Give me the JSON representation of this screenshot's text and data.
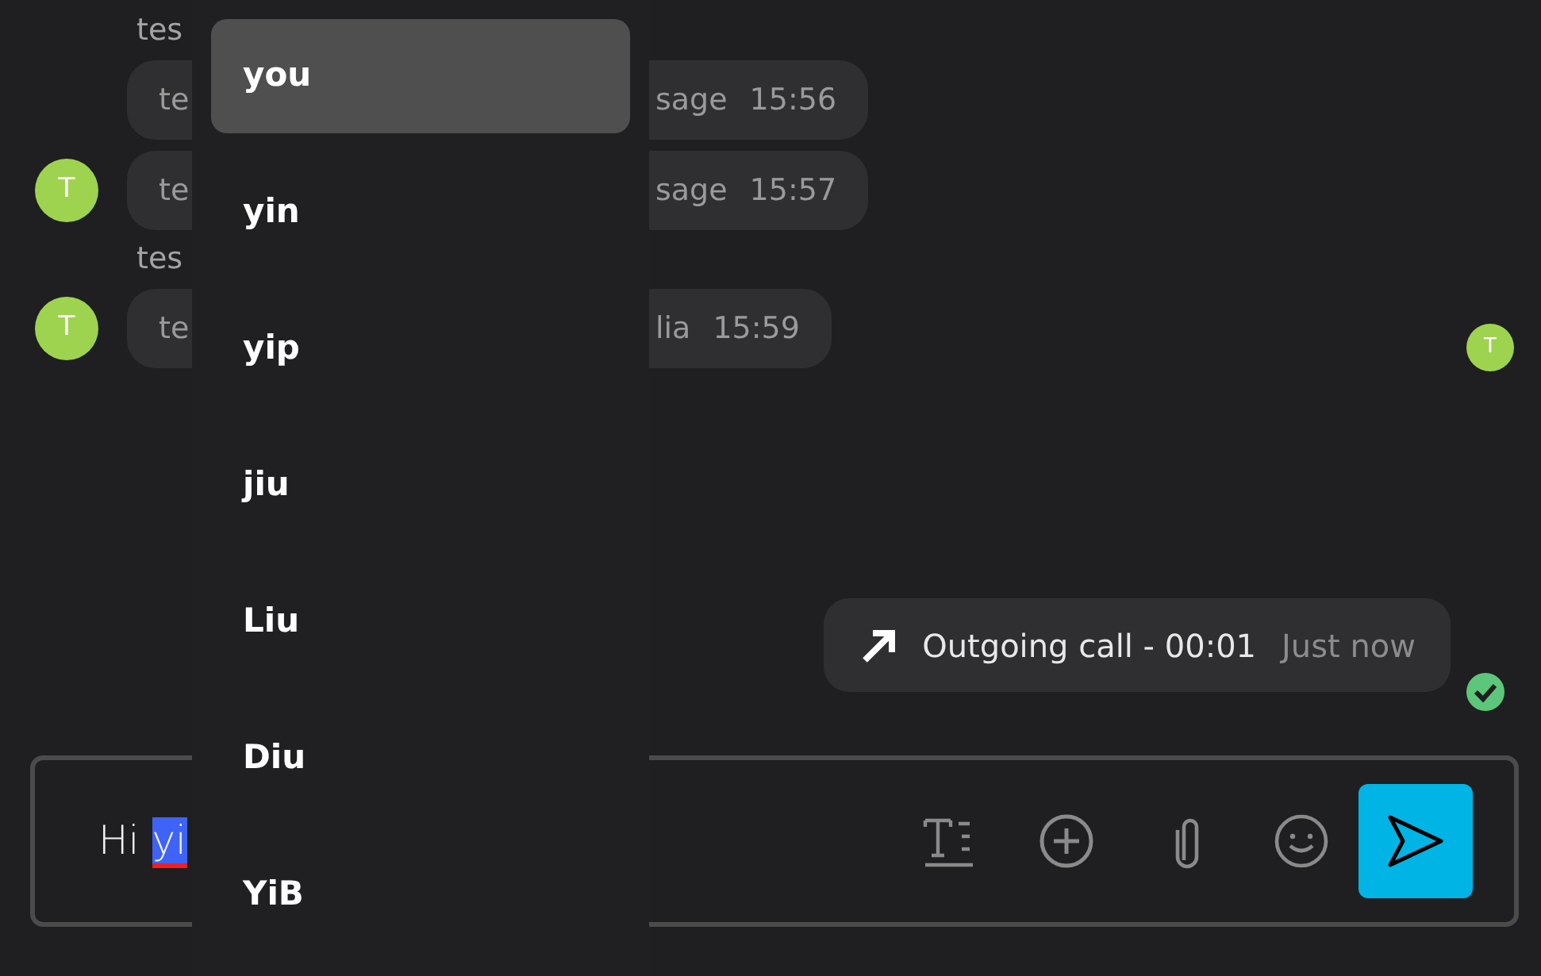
{
  "messages": [
    {
      "kind": "sender",
      "name": "tes"
    },
    {
      "kind": "bubble",
      "start": "te",
      "end": "sage",
      "time": "15:56"
    },
    {
      "kind": "bubble",
      "avatar": "T",
      "start": "te",
      "end": "sage",
      "time": "15:57"
    },
    {
      "kind": "sender",
      "name": "tes"
    },
    {
      "kind": "bubble",
      "avatar": "T",
      "start": "te",
      "end": "lia",
      "time": "15:59",
      "reader": "T"
    }
  ],
  "call": {
    "label": "Outgoing call - 00:01",
    "time": "Just now",
    "delivered": true
  },
  "composer": {
    "text": "Hi",
    "selection": "yi"
  },
  "suggestions": [
    {
      "label": "you",
      "selected": true
    },
    {
      "label": "yin",
      "selected": false
    },
    {
      "label": "yip",
      "selected": false
    },
    {
      "label": "jiu",
      "selected": false
    },
    {
      "label": "Liu",
      "selected": false
    },
    {
      "label": "Diu",
      "selected": false
    },
    {
      "label": "YiB",
      "selected": false
    }
  ]
}
